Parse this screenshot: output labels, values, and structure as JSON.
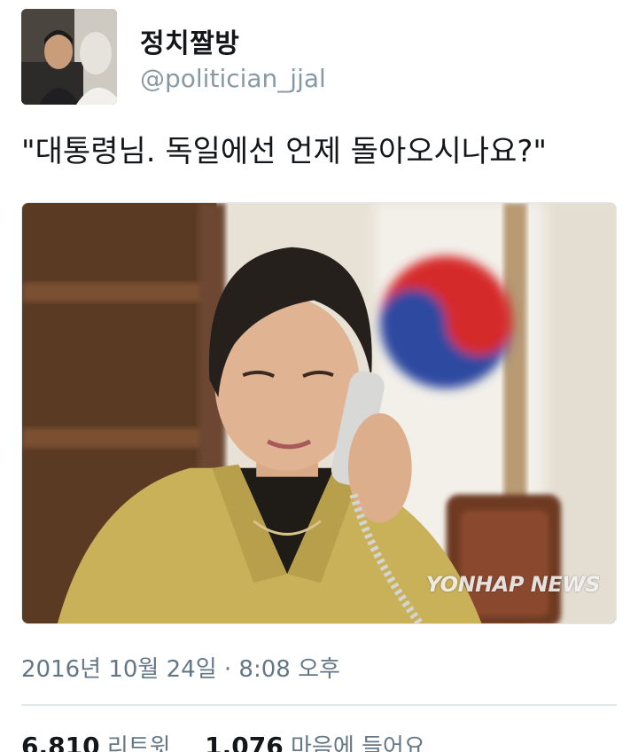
{
  "tweet": {
    "display_name": "정치짤방",
    "handle": "@politician_jjal",
    "text": "\"대통령님. 독일에선 언제 돌아오시나요?\"",
    "timestamp": "2016년 10월 24일 · 8:08 오후",
    "photo_watermark": "YONHAP NEWS"
  },
  "stats": {
    "retweets_count": "6,810",
    "retweets_label": "리트윗",
    "likes_count": "1,076",
    "likes_label": "마음에 들어요"
  }
}
